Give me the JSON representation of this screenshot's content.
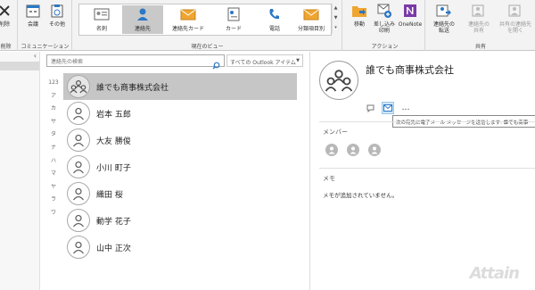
{
  "ribbon": {
    "delete_group": {
      "label": "削除",
      "caption": "削除"
    },
    "communication": {
      "caption": "コミュニケーション",
      "meeting": "会議",
      "other": "その他"
    },
    "current_view": {
      "caption": "現在のビュー",
      "items": [
        "名刺",
        "連絡先",
        "連絡先カード",
        "カード",
        "電話",
        "分類項目別"
      ],
      "selected": "連絡先"
    },
    "actions": {
      "caption": "アクション",
      "move": "移動",
      "mail_merge": "差し込み\n印刷",
      "onenote": "OneNote"
    },
    "share": {
      "caption": "共有",
      "forward": "連絡先の\n転送",
      "share_contacts": "連絡先の\n共有",
      "open_shared": "共有の連絡先\nを開く"
    }
  },
  "leftnav": {
    "collapse_glyph": "‹"
  },
  "search": {
    "placeholder": "連絡先の検索",
    "scope": "すべての Outlook アイテム"
  },
  "index": [
    "123",
    "ア",
    "カ",
    "サ",
    "タ",
    "ナ",
    "ハ",
    "マ",
    "ヤ",
    "ラ",
    "ワ"
  ],
  "contacts": [
    {
      "name": "誰でも商事株式会社",
      "type": "group",
      "selected": true
    },
    {
      "name": "岩本 五郎",
      "type": "person",
      "selected": false
    },
    {
      "name": "大友 勝俊",
      "type": "person",
      "selected": false
    },
    {
      "name": "小川 町子",
      "type": "person",
      "selected": false
    },
    {
      "name": "織田 桜",
      "type": "person",
      "selected": false
    },
    {
      "name": "動学 花子",
      "type": "person",
      "selected": false
    },
    {
      "name": "山中 正次",
      "type": "person",
      "selected": false
    }
  ],
  "detail": {
    "title": "誰でも商事株式会社",
    "more": "…",
    "tooltip": "次の宛先に電子メール メッセージを送信します: 誰でも商事",
    "members_header": "メンバー",
    "memo_header": "メモ",
    "memo_text": "メモが追加されていません。",
    "member_count": 3
  },
  "watermark": "Attain",
  "colors": {
    "ribbon_bg": "#f3f3f3",
    "selected_row": "#c6c6c6",
    "accent_blue": "#2b78c5",
    "onenote_purple": "#7a3aa6",
    "folder_orange": "#f0a531"
  }
}
